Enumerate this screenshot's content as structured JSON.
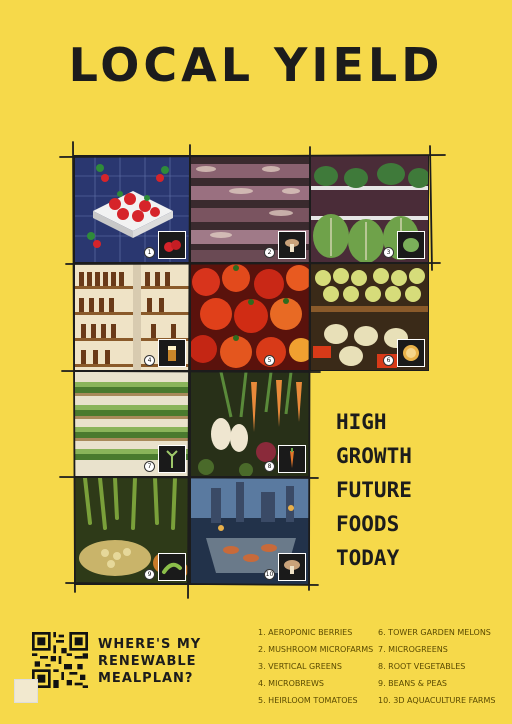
{
  "title": "LOCAL YIELD",
  "tagline": [
    "HIGH",
    "GROWTH",
    "FUTURE",
    "FOODS",
    "TODAY"
  ],
  "cta": [
    "WHERE'S MY",
    "RENEWABLE",
    "MEALPLAN?"
  ],
  "list_left": [
    "1. AEROPONIC BERRIES",
    "2. MUSHROOM MICROFARMS",
    "3. VERTICAL GREENS",
    "4. MICROBREWS",
    "5. HEIRLOOM TOMATOES"
  ],
  "list_right": [
    "6. TOWER GARDEN MELONS",
    "7. MICROGREENS",
    "8. ROOT VEGETABLES",
    "9. BEANS & PEAS",
    "10. 3D AQUACULTURE FARMS"
  ],
  "tiles": [
    {
      "name": "aeroponic-berries",
      "number": "1"
    },
    {
      "name": "mushroom-microfarms",
      "number": "2"
    },
    {
      "name": "vertical-greens",
      "number": "3"
    },
    {
      "name": "microbrews",
      "number": "4"
    },
    {
      "name": "heirloom-tomatoes",
      "number": "5"
    },
    {
      "name": "tower-garden-melons",
      "number": "6"
    },
    {
      "name": "microgreens",
      "number": "7"
    },
    {
      "name": "root-vegetables",
      "number": "8"
    },
    {
      "name": "beans-and-peas",
      "number": "9"
    },
    {
      "name": "aquaculture-farms",
      "number": "10"
    }
  ],
  "colors": {
    "background": "#f6d94a",
    "ink": "#1c1c1c",
    "list_text": "#5a4a00"
  }
}
